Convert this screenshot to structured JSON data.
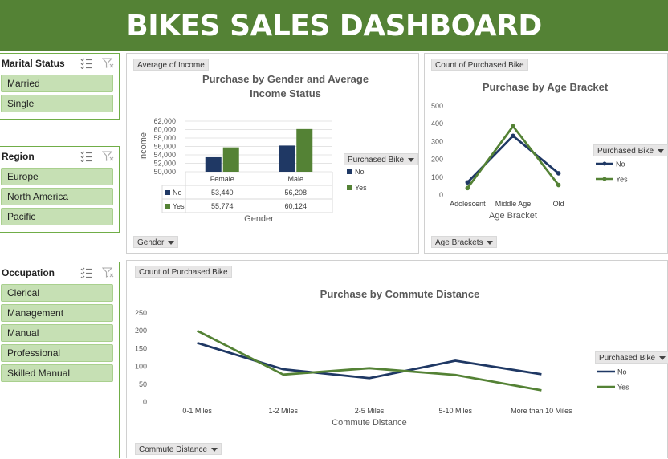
{
  "banner": {
    "title": "BIKES SALES DASHBOARD"
  },
  "slicers": {
    "marital_status": {
      "title": "Marital Status",
      "items": [
        "Married",
        "Single"
      ]
    },
    "region": {
      "title": "Region",
      "items": [
        "Europe",
        "North America",
        "Pacific"
      ]
    },
    "occupation": {
      "title": "Occupation",
      "items": [
        "Clerical",
        "Management",
        "Manual",
        "Professional",
        "Skilled Manual"
      ]
    }
  },
  "colors": {
    "no": "#1f3864",
    "yes": "#548235",
    "banner": "#548235",
    "slicer_item": "#c6e0b4"
  },
  "chart_data": [
    {
      "type": "bar",
      "title": "Purchase by Gender and Average Income Status",
      "value_field": "Average of Income",
      "axis_field": "Gender",
      "legend_field": "Purchased Bike",
      "xlabel": "Gender",
      "ylabel": "Income",
      "categories": [
        "Female",
        "Male"
      ],
      "series": [
        {
          "name": "No",
          "values": [
            53440,
            56208
          ],
          "labels": [
            "53,440",
            "56,208"
          ]
        },
        {
          "name": "Yes",
          "values": [
            55774,
            60124
          ],
          "labels": [
            "55,774",
            "60,124"
          ]
        }
      ],
      "ylim": [
        50000,
        62000
      ],
      "yticks": [
        "62,000",
        "60,000",
        "58,000",
        "56,000",
        "54,000",
        "52,000",
        "50,000"
      ],
      "data_table": true
    },
    {
      "type": "line",
      "title": "Purchase by Age Bracket",
      "value_field": "Count of Purchased Bike",
      "axis_field": "Age Brackets",
      "legend_field": "Purchased Bike",
      "xlabel": "Age Bracket",
      "categories": [
        "Adolescent",
        "Middle Age",
        "Old"
      ],
      "series": [
        {
          "name": "No",
          "values": [
            71,
            332,
            122
          ]
        },
        {
          "name": "Yes",
          "values": [
            39,
            386,
            56
          ]
        }
      ],
      "ylim": [
        0,
        500
      ],
      "yticks": [
        "500",
        "400",
        "300",
        "200",
        "100",
        "0"
      ],
      "markers": true
    },
    {
      "type": "line",
      "title": "Purchase by Commute Distance",
      "value_field": "Count of Purchased Bike",
      "axis_field": "Commute Distance",
      "legend_field": "Purchased Bike",
      "xlabel": "Commute Distance",
      "categories": [
        "0-1 Miles",
        "1-2 Miles",
        "2-5 Miles",
        "5-10 Miles",
        "More than 10 Miles"
      ],
      "series": [
        {
          "name": "No",
          "values": [
            166,
            92,
            67,
            116,
            78
          ]
        },
        {
          "name": "Yes",
          "values": [
            200,
            77,
            95,
            76,
            33
          ]
        }
      ],
      "ylim": [
        0,
        250
      ],
      "yticks": [
        "250",
        "200",
        "150",
        "100",
        "50",
        "0"
      ]
    }
  ]
}
